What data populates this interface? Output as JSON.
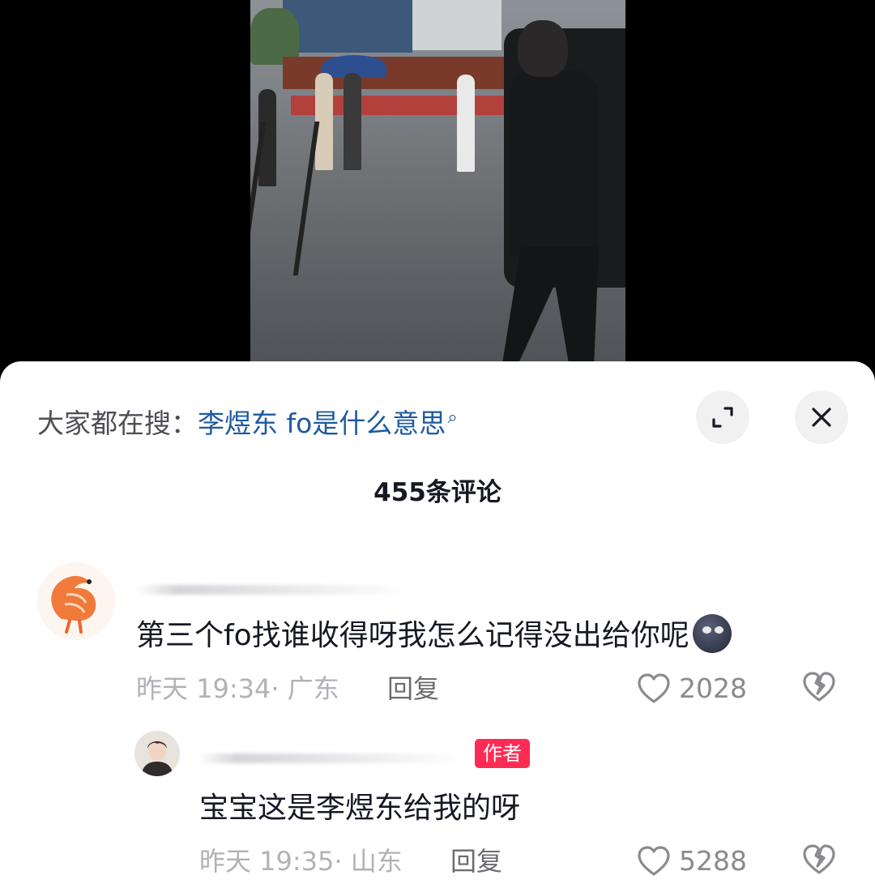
{
  "search": {
    "prefix": "大家都在搜：",
    "query": "李煜东 fo是什么意思",
    "glass": "⌕"
  },
  "header": {
    "comment_count": "455条评论"
  },
  "comments": [
    {
      "avatar_icon": "shrimp-avatar-icon",
      "text": "第三个fo找谁收得呀我怎么记得没出给你呢",
      "emoji_icon": "moon-face-emoji",
      "time": "昨天 19:34",
      "location": "广东",
      "reply_label": "回复",
      "likes": "2028"
    }
  ],
  "reply": {
    "avatar_icon": "portrait-avatar-icon",
    "badge": "作者",
    "text": "宝宝这是李煜东给我的呀",
    "time": "昨天 19:35",
    "location": "山东",
    "reply_label": "回复",
    "likes": "5288"
  },
  "colors": {
    "link_blue": "#1d5aa0",
    "author_badge": "#fe2c55",
    "meta_gray": "#b1b2b7"
  }
}
